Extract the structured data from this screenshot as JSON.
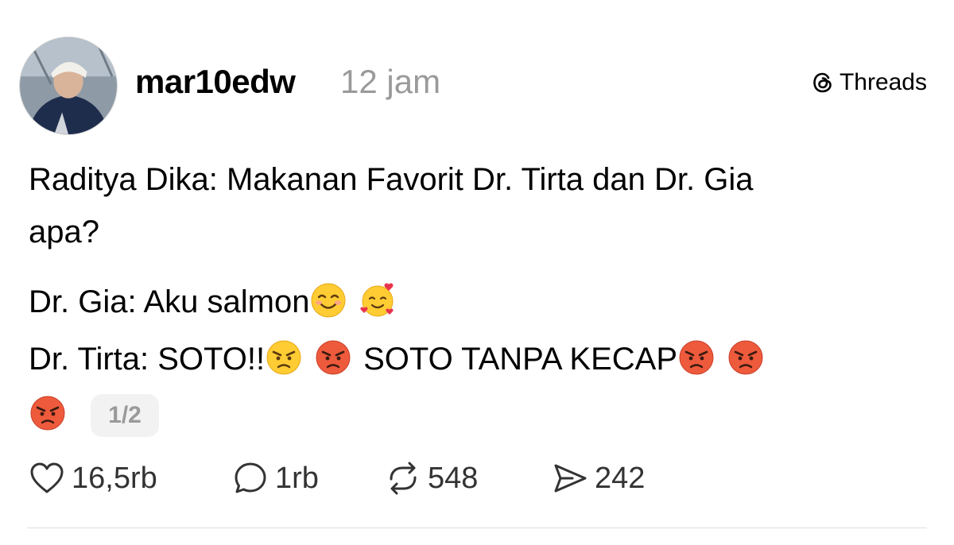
{
  "post": {
    "author": {
      "username": "mar10edw",
      "time": "12 jam",
      "avatar_icon": "profile-photo"
    },
    "brand": {
      "label": "Threads",
      "icon": "threads-logo-icon"
    },
    "text_lines": [
      "Raditya Dika: Makanan Favorit Dr. Tirta dan Dr. Gia",
      "apa?",
      "Dr. Gia: Aku salmon",
      "Dr. Tirta: SOTO!!",
      "SOTO TANPA KECAP"
    ],
    "emojis": {
      "gia": [
        "smiling-face-with-smiling-eyes",
        "smiling-face-with-hearts"
      ],
      "tirta": [
        "angry-face",
        "pouting-face",
        "pouting-face",
        "pouting-face",
        "pouting-face"
      ]
    },
    "pagination": "1/2",
    "actions": {
      "likes": "16,5rb",
      "replies": "1rb",
      "reposts": "548",
      "shares": "242"
    }
  },
  "colors": {
    "text": "#000000",
    "muted": "#9a9a9a",
    "count": "#333333",
    "pill_bg": "#f2f2f2",
    "divider": "#dddddd",
    "emoji_angry": "#e74c3c",
    "emoji_yellow": "#ffcc33"
  }
}
